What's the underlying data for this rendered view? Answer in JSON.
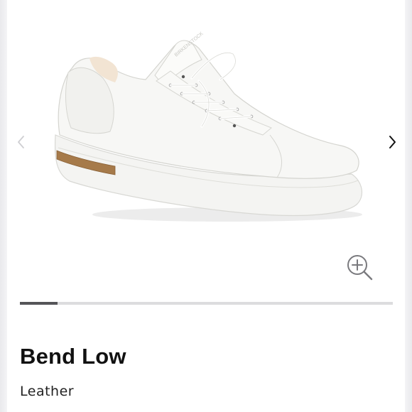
{
  "product": {
    "name": "Bend Low",
    "material": "Leather",
    "image_icon": "white-leather-sneaker-image"
  },
  "gallery": {
    "prev_icon": "chevron-left-icon",
    "next_icon": "chevron-right-icon",
    "zoom_icon": "zoom-in-icon",
    "progress": 0.1
  },
  "colors": {
    "progress_fill": "#555558",
    "progress_track": "#dcdcde",
    "cork": "#a67a4a",
    "text": "#111111"
  }
}
